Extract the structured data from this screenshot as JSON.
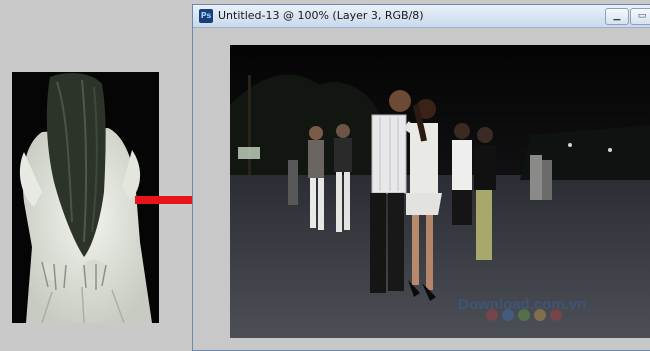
{
  "window": {
    "title": "Untitled-13 @ 100% (Layer 3, RGB/8)",
    "icon": "photoshop-document-icon",
    "min_glyph": "▁",
    "max_glyph": "▭"
  },
  "arrow": {
    "color": "#e8141b"
  },
  "source_image": {
    "subject": "ghost-girl"
  },
  "photo": {
    "subject": "couples-dancing-at-night",
    "watermark": "Download.com.vn"
  }
}
